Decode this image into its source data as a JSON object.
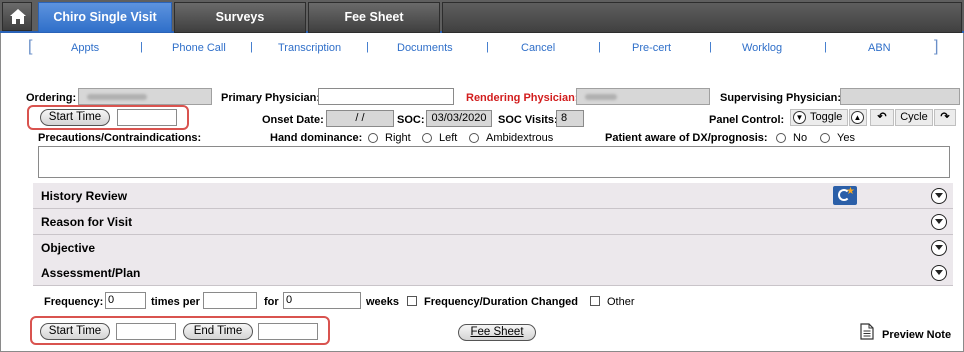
{
  "tabs": [
    {
      "label": "Chiro Single Visit",
      "active": true
    },
    {
      "label": "Surveys",
      "active": false
    },
    {
      "label": "Fee Sheet",
      "active": false
    }
  ],
  "subnav": [
    "Appts",
    "Phone Call",
    "Transcription",
    "Documents",
    "Cancel",
    "Pre-cert",
    "Worklog",
    "ABN"
  ],
  "subnav_separator": "|",
  "fields": {
    "ordering_label": "Ordering:",
    "primary_physician_label": "Primary Physician:",
    "primary_physician_value": "",
    "rendering_physician_label": "Rendering Physician:",
    "supervising_physician_label": "Supervising Physician:",
    "start_time_button": "Start Time",
    "start_time_value": "",
    "onset_date_label": "Onset Date:",
    "onset_date_value": "/ /",
    "soc_label": "SOC:",
    "soc_value": "03/03/2020",
    "soc_visits_label": "SOC Visits:",
    "soc_visits_value": "8",
    "panel_control_label": "Panel Control:",
    "toggle_label": "Toggle",
    "cycle_label": "Cycle",
    "precautions_label": "Precautions/Contraindications:",
    "hand_dominance_label": "Hand dominance:",
    "hand_options": [
      "Right",
      "Left",
      "Ambidextrous"
    ],
    "patient_aware_label": "Patient aware of DX/prognosis:",
    "aware_options": [
      "No",
      "Yes"
    ]
  },
  "sections": [
    "History Review",
    "Reason for Visit",
    "Objective",
    "Assessment/Plan"
  ],
  "frequency": {
    "label": "Frequency:",
    "value": "0",
    "times_per_label": "times per",
    "times_per_value": "",
    "for_label": "for",
    "for_value": "0",
    "weeks_label": "weeks",
    "changed_label": "Frequency/Duration Changed",
    "other_label": "Other"
  },
  "footer": {
    "start_time_button": "Start Time",
    "start_time_value": "",
    "end_time_button": "End Time",
    "end_time_value": "",
    "fee_sheet_button": "Fee Sheet",
    "preview_note": "Preview Note"
  },
  "colors": {
    "active_tab": "#2f6fc9",
    "link": "#2f6fc9",
    "rendering_label": "#d21d1d",
    "highlight_box": "#d9534f"
  }
}
